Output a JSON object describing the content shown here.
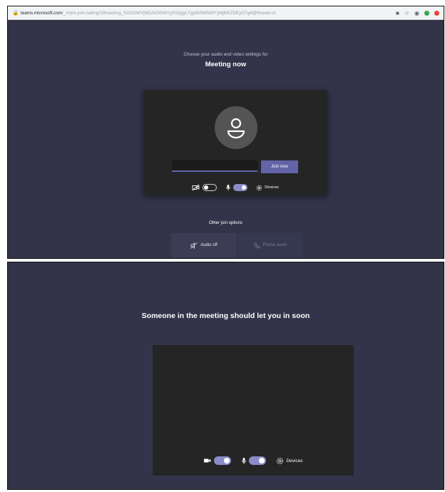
{
  "browser": {
    "url_host": "teams.microsoft.com",
    "url_path": "/_#/pre-join-calling/19meeting_N2IzOWVjNDAtOWI4Yy00ZjgyLTgyM2MtNWYyMjM0ZDEyOTg4@thread.v2"
  },
  "prejoin": {
    "subtitle": "Choose your audio and video settings for",
    "meeting_title": "Meeting now",
    "name_value": "",
    "join_label": "Join now",
    "camera_on": false,
    "mic_on": true,
    "devices_label": "Devices",
    "other_options_label": "Other join options",
    "audio_off_label": "Audio off",
    "phone_audio_label": "Phone audio"
  },
  "waiting": {
    "message": "Someone in the meeting should let you in soon",
    "camera_on": true,
    "mic_on": true,
    "devices_label": "Devices"
  },
  "colors": {
    "background": "#33344a",
    "card": "#252526",
    "accent": "#6264a7",
    "toggle_on": "#8b8cc7"
  }
}
